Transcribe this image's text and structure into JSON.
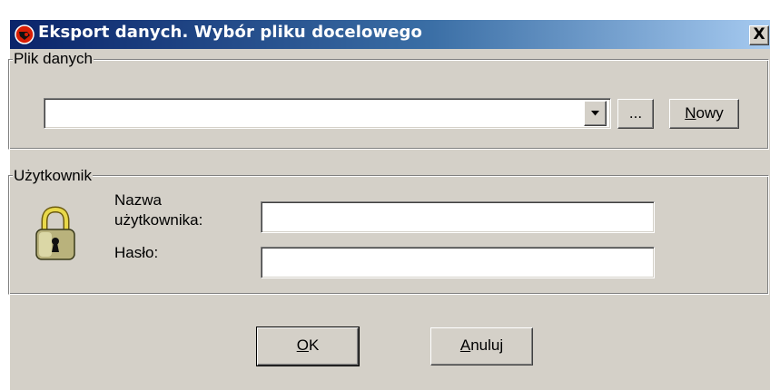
{
  "window": {
    "title": "Eksport danych. Wybór pliku docelowego",
    "close_symbol": "X"
  },
  "file_group": {
    "legend": "Plik danych",
    "file_combo": {
      "value": ""
    },
    "dropdown_icon": "chevron-down-icon",
    "browse_label": "...",
    "new_label_mnemonic": "N",
    "new_label_rest": "owy"
  },
  "user_group": {
    "legend": "Użytkownik",
    "lock_icon": "padlock-icon",
    "username_label_line1": "Nazwa",
    "username_label_line2": "użytkownika:",
    "username_value": "",
    "password_label": "Hasło:",
    "password_value": ""
  },
  "buttons": {
    "ok_mnemonic": "O",
    "ok_rest": "K",
    "cancel_mnemonic": "A",
    "cancel_rest": "nuluj"
  },
  "colors": {
    "face": "#d4d0c8",
    "title_start": "#0a246a",
    "title_end": "#a6caf0"
  }
}
